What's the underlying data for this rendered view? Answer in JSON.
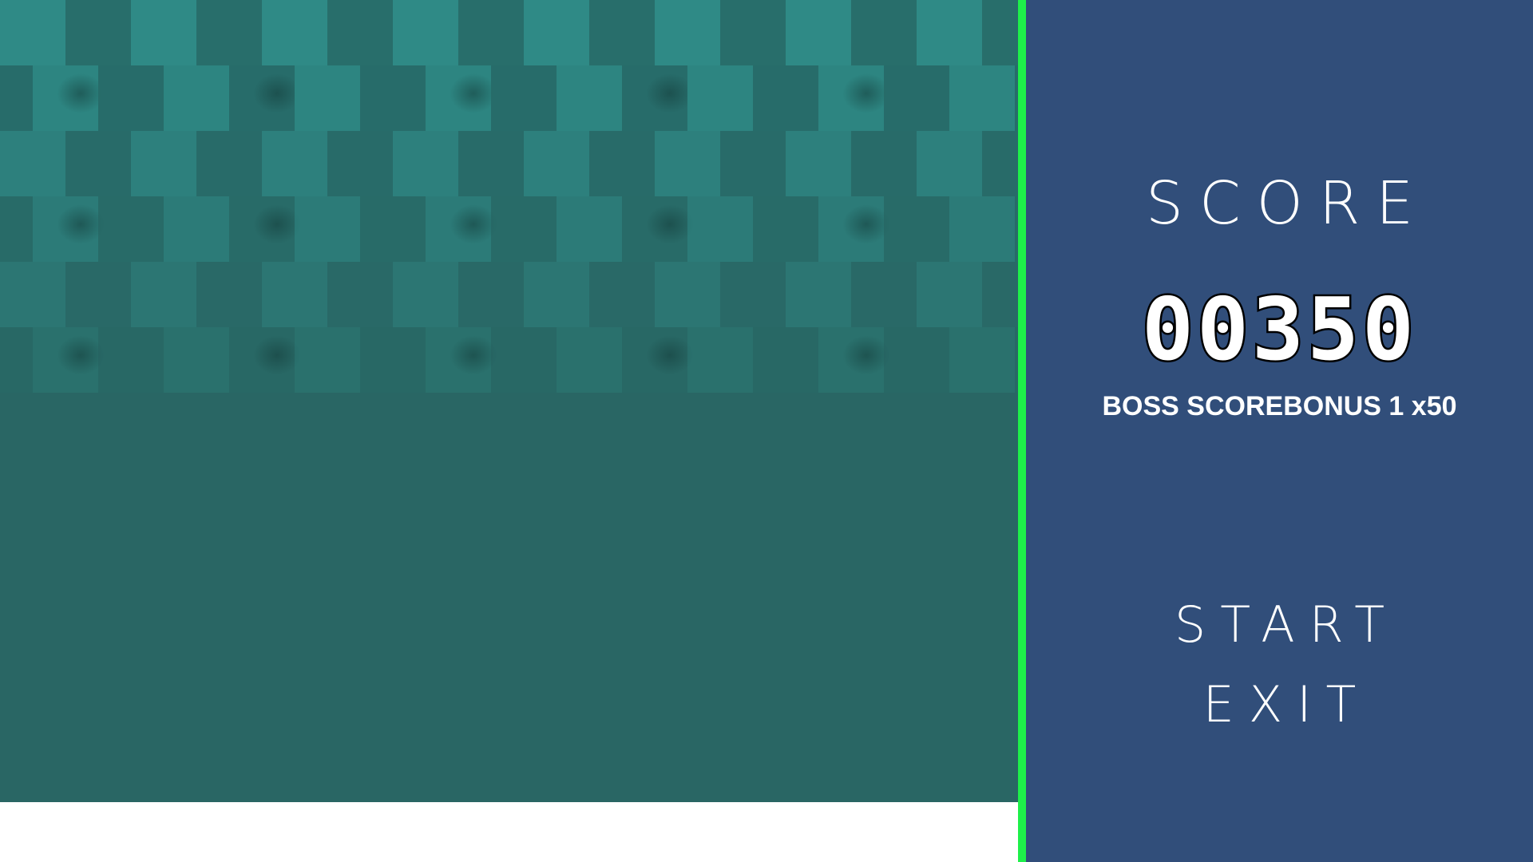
{
  "colors": {
    "playfield_bg": "#296664",
    "tile_light": "#2f8a86",
    "tile_dark": "#286e6b",
    "divider": "#1ef04a",
    "panel_bg": "#314e7a",
    "text": "#ffffff"
  },
  "panel": {
    "score_label": "SCORE",
    "score_value": "00350",
    "bonus_text": "BOSS SCOREBONUS 1 x50"
  },
  "menu": {
    "start_label": "START",
    "exit_label": "EXIT"
  }
}
